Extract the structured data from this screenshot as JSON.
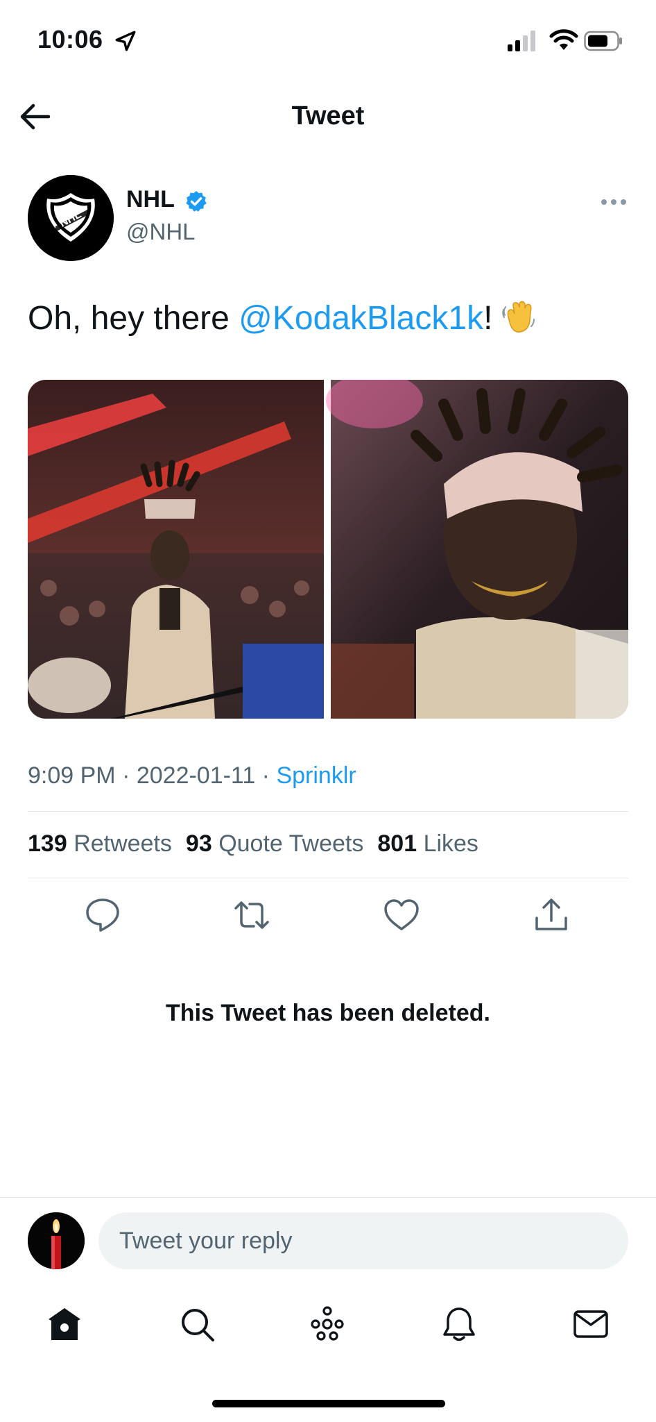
{
  "status_bar": {
    "time": "10:06",
    "icons": [
      "location-arrow-icon",
      "cellular-signal-icon",
      "wifi-icon",
      "battery-icon"
    ]
  },
  "header": {
    "title": "Tweet",
    "back_icon": "back-arrow-icon"
  },
  "tweet": {
    "author_name": "NHL",
    "author_handle": "@NHL",
    "verified": true,
    "text_prefix": "Oh, hey there ",
    "mention": "@KodakBlack1k",
    "text_suffix": "!",
    "emoji_icon": "waving-hand-icon",
    "timestamp": "9:09 PM · 2022-01-11 · ",
    "source": "Sprinklr",
    "stats": {
      "retweets_count": "139",
      "retweets_label": "Retweets",
      "quotes_count": "93",
      "quotes_label": "Quote Tweets",
      "likes_count": "801",
      "likes_label": "Likes"
    },
    "actions": [
      "reply-icon",
      "retweet-icon",
      "like-icon",
      "share-icon"
    ]
  },
  "deleted_notice": "This Tweet has been deleted.",
  "reply_bar": {
    "placeholder": "Tweet your reply"
  },
  "tab_bar": [
    "home-icon",
    "search-icon",
    "spaces-icon",
    "notifications-icon",
    "messages-icon"
  ],
  "colors": {
    "accent": "#1d9bf0",
    "text_primary": "#0f1419",
    "text_secondary": "#536471",
    "input_background": "#eff3f4"
  }
}
